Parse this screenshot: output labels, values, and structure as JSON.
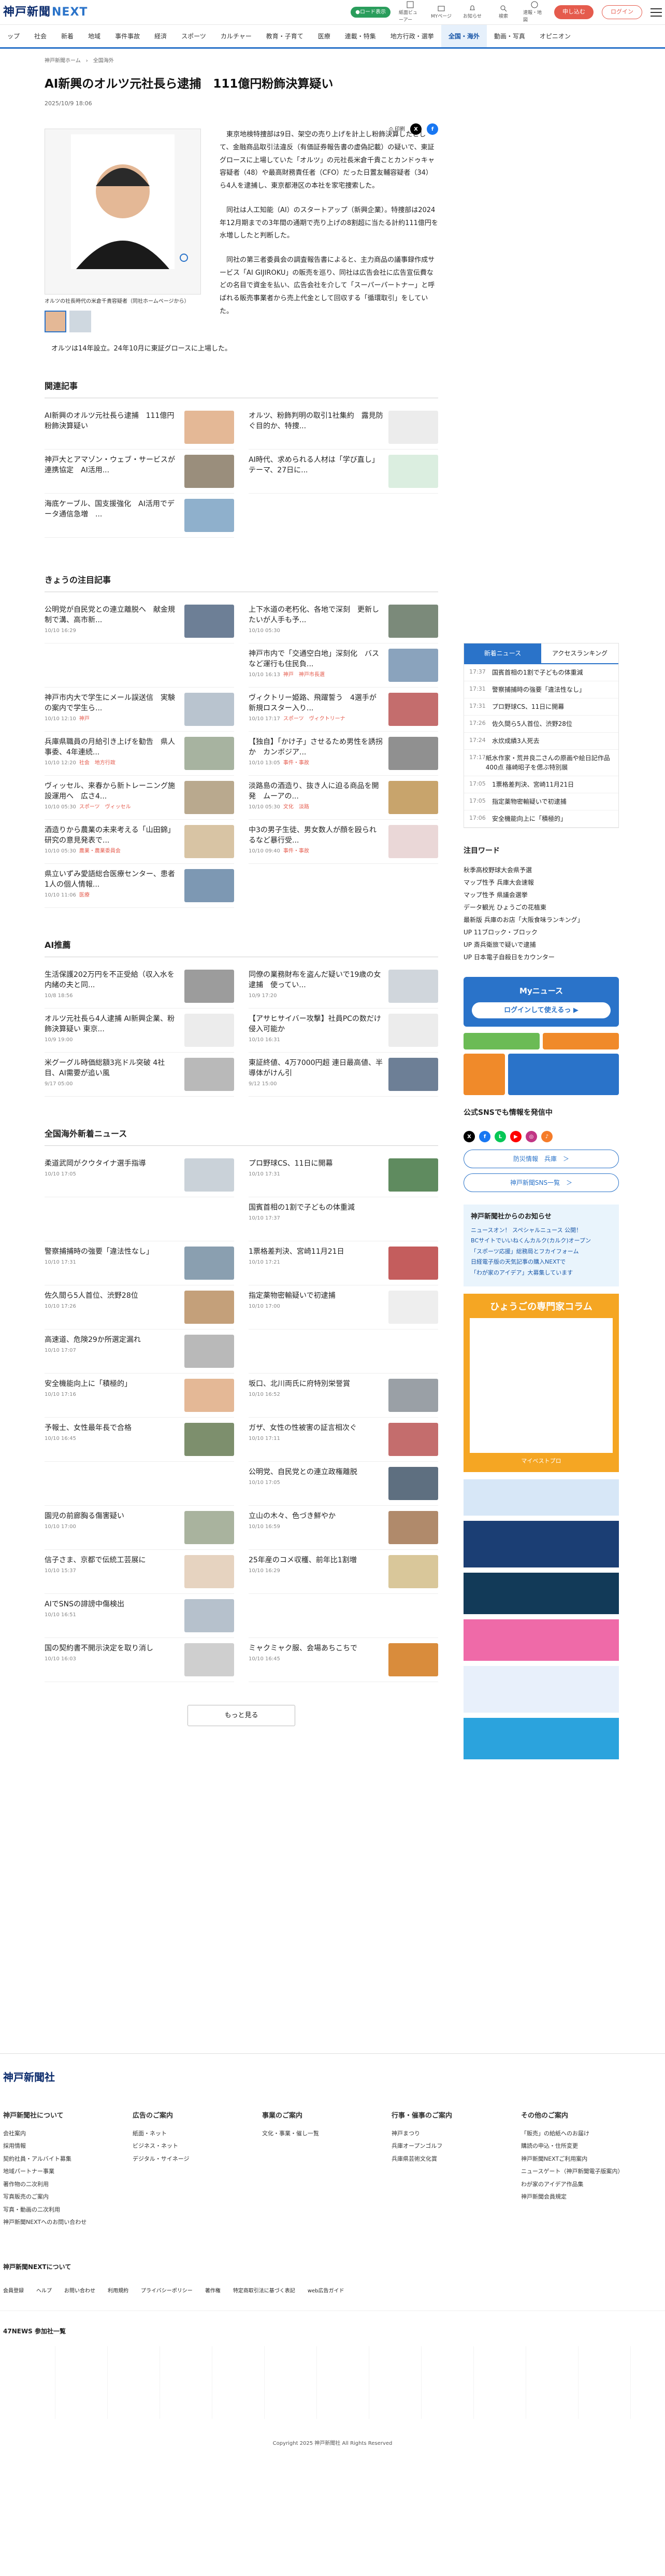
{
  "header": {
    "logo_main": "神戸新聞",
    "logo_sub": "NEXT",
    "top_pill": "●ロード表示",
    "icons": [
      {
        "name": "paper-icon",
        "label": "紙面ビューアー"
      },
      {
        "name": "myfolder-icon",
        "label": "MYページ"
      },
      {
        "name": "bell-icon",
        "label": "お知らせ"
      },
      {
        "name": "search-icon",
        "label": "検索"
      },
      {
        "name": "sitemap-icon",
        "label": "速報・地図"
      }
    ],
    "apply": "申し込む",
    "login": "ログイン"
  },
  "gnav": [
    "ップ",
    "社会",
    "事件事故",
    "新着",
    "地域",
    "経済",
    "スポーツ",
    "カルチャー",
    "教育・子育て",
    "医療",
    "連載・特集",
    "地方行政・選挙",
    "全国・海外",
    "動画・写真",
    "オピニオン"
  ],
  "breadcrumb": [
    "神戸新聞ホーム",
    "全国海外"
  ],
  "article": {
    "title": "AI新興のオルツ元社長ら逮捕　111億円粉飾決算疑い",
    "date": "2025/10/9 18:06",
    "print": "印刷",
    "photo_caption": "オルツの社長時代の米倉千貴容疑者（同社ホームページから）",
    "paragraphs": [
      "　東京地検特捜部は9日、架空の売り上げを計上し粉飾決算したとして、金融商品取引法違反（有価証券報告書の虚偽記載）の疑いで、東証グロースに上場していた「オルツ」の元社長米倉千貴ことカンドゥキャ容疑者（48）や最高財務責任者（CFO）だった日置友輔容疑者（34）ら4人を逮捕し、東京都港区の本社を家宅捜索した。",
      "　同社は人工知能（AI）のスタートアップ（新興企業）。特捜部は2024年12月期までの3年間の通期で売り上げの8割超に当たる計約111億円を水増ししたと判断した。",
      "　同社の第三者委員会の調査報告書によると、主力商品の議事録作成サービス「AI GIJIROKU」の販売を巡り、同社は広告会社に広告宣伝費などの名目で資金を払い、広告会社を介して「スーパーパートナー」と呼ばれる販売事業者から売上代金として回収する「循環取引」をしていた。",
      "　オルツは14年設立。24年10月に東証グロースに上場した。"
    ]
  },
  "related": {
    "heading": "関連記事",
    "items": [
      {
        "title": "AI新興のオルツ元社長ら逮捕　111億円粉飾決算疑い",
        "meta": ""
      },
      {
        "title": "オルツ、粉飾判明の取引1社集約　露見防ぐ目的か、特捜...",
        "meta": ""
      },
      {
        "title": "神戸大とアマゾン・ウェブ・サービスが連携協定　AI活用...",
        "meta": ""
      },
      {
        "title": "AI時代、求められる人材は「学び直し」テーマ、27日に...",
        "meta": ""
      },
      {
        "title": "海底ケーブル、国支援強化　AI活用でデータ通信急増　...",
        "meta": ""
      }
    ]
  },
  "today": {
    "heading": "きょうの注目記事",
    "items": [
      {
        "title": "公明党が自民党との連立離脱へ　献金規制で溝、高市新...",
        "meta": "10/10 16:29"
      },
      {
        "title": "上下水道の老朽化、各地で深刻　更新したいが人手も予...",
        "meta": "10/10 05:30"
      },
      {
        "title": "",
        "meta": ""
      },
      {
        "title": "神戸市内で「交通空白地」深刻化　バスなど運行も住民負...",
        "meta": "10/10 16:13",
        "cat": "神戸　神戸市長選"
      },
      {
        "title": "神戸市内大で学生にメール誤送信　実験の案内で学生ら...",
        "meta": "10/10 12:10",
        "cat": "神戸"
      },
      {
        "title": "ヴィクトリー姫路、飛躍誓う　4選手が新規ロスター入り...",
        "meta": "10/10 17:17",
        "cat": "スポーツ　ヴィクトリーナ"
      },
      {
        "title": "兵庫県職員の月給引き上げを勧告　県人事委、4年連続...",
        "meta": "10/10 12:20",
        "cat": "社会　地方行政"
      },
      {
        "title": "【独自】「かけ子」させるため男性を誘拐か　カンボジア...",
        "meta": "10/10 13:05",
        "cat": "事件・事故"
      },
      {
        "title": "ヴィッセル、来春から新トレーニング施設運用へ　広さ4...",
        "meta": "10/10 05:30",
        "cat": "スポーツ　ヴィッセル"
      },
      {
        "title": "淡路島の酒造り、抜き人に迫る商品を開発　ムーアの...",
        "meta": "10/10 05:30",
        "cat": "文化　淡路"
      },
      {
        "title": "酒造りから農業の未来考える「山田錦」研究の意見発表で...",
        "meta": "10/10 05:30",
        "cat": "農業・農業委員会"
      },
      {
        "title": "中3の男子生徒、男女数人が顔を殴られるなど暴行受...",
        "meta": "10/10 09:40",
        "cat": "事件・事故"
      },
      {
        "title": "県立いずみ愛語総合医療センター、患者1人の個人情報...",
        "meta": "10/10 11:06",
        "cat": "医療"
      }
    ]
  },
  "ai": {
    "heading": "AI推薦",
    "items": [
      {
        "title": "生活保護202万円を不正受給（収入水を内緒の夫と同...",
        "meta": "10/8 18:56"
      },
      {
        "title": "同僚の業務財布を盗んだ疑いで19歳の女逮捕　使ってい...",
        "meta": "10/9 17:20"
      },
      {
        "title": "オルツ元社長ら4人逮捕 AI新興企業、粉飾決算疑い 東京...",
        "meta": "10/9 19:00"
      },
      {
        "title": "【アサヒサイバー攻撃】社員PCの数だけ侵入可能か",
        "meta": "10/10 16:31"
      },
      {
        "title": "米グーグル時価総額3兆ドル突破 4社目、AI需要が追い風",
        "meta": "9/17 05:00"
      },
      {
        "title": "東証終値、4万7000円超 連日最高値、半導体がけん引",
        "meta": "9/12 15:00"
      }
    ]
  },
  "national": {
    "heading": "全国海外新着ニュース",
    "items": [
      {
        "title": "柔道武岡がクウタイナ選手指導",
        "meta": "10/10 17:05"
      },
      {
        "title": "プロ野球CS、11日に開幕",
        "meta": "10/10 17:31"
      },
      {
        "title": "",
        "meta": ""
      },
      {
        "title": "国賓首相の1割で子どもの体重減",
        "meta": "10/10 17:37"
      },
      {
        "title": "警察捕捕時の強要「違法性なし」",
        "meta": "10/10 17:31"
      },
      {
        "title": "1票格差判決、宮崎11月21日",
        "meta": "10/10 17:21"
      },
      {
        "title": "佐久間ら5人首位、渋野28位",
        "meta": "10/10 17:26"
      },
      {
        "title": "指定薬物密輸疑いで初逮捕",
        "meta": "10/10 17:00"
      },
      {
        "title": "高速道、危険29か所選定漏れ",
        "meta": "10/10 17:07"
      },
      {
        "title": "",
        "meta": ""
      },
      {
        "title": "安全機能向上に「積極的」",
        "meta": "10/10 17:16"
      },
      {
        "title": "坂口、北川両氏に府特別栄誉賞",
        "meta": "10/10 16:52"
      },
      {
        "title": "予報士、女性最年長で合格",
        "meta": "10/10 16:45"
      },
      {
        "title": "ガザ、女性の性被害の証言相次ぐ",
        "meta": "10/10 17:11"
      },
      {
        "title": "",
        "meta": ""
      },
      {
        "title": "公明党、自民党との連立政権離脱",
        "meta": "10/10 17:05"
      },
      {
        "title": "園児の前廊胸る傷害疑い",
        "meta": "10/10 17:00"
      },
      {
        "title": "立山の木々、色づき鮮やか",
        "meta": "10/10 16:59"
      },
      {
        "title": "信子さま、京都で伝統工芸展に",
        "meta": "10/10 15:37"
      },
      {
        "title": "25年産のコメ収穫、前年比1割増",
        "meta": "10/10 16:29"
      },
      {
        "title": "AIでSNSの誹謗中傷検出",
        "meta": "10/10 16:51"
      },
      {
        "title": "",
        "meta": ""
      },
      {
        "title": "国の契約書不開示決定を取り消し",
        "meta": "10/10 16:03"
      },
      {
        "title": "ミャクミャク服、会場あちこちで",
        "meta": "10/10 16:45"
      }
    ],
    "more": "もっと見る"
  },
  "side": {
    "tabs": [
      "新着ニュース",
      "アクセスランキング"
    ],
    "ranks": [
      [
        "17:37",
        "国賓首相の1割で子どもの体重減"
      ],
      [
        "17:31",
        "警察捕捕時の強要「違法性なし」"
      ],
      [
        "17:31",
        "プロ野球CS、11日に開幕"
      ],
      [
        "17:26",
        "佐久間ら5人首位、渋野28位"
      ],
      [
        "17:24",
        "水炊成績3人死去"
      ],
      [
        "17:17",
        "紙水作家・荒井良二さんの原画や絵日記作品400点 篠崎昭子を偲ぶ特別展"
      ],
      [
        "17:05",
        "1票格差判決、宮崎11月21日"
      ],
      [
        "17:05",
        "指定薬物密輸疑いで初逮捕"
      ],
      [
        "17:06",
        "安全機能向上に「積極的」"
      ]
    ],
    "ward_h": "注目ワード",
    "wards": [
      "秋季高校野球大会県予選",
      "マップ性予 兵庫大会速報",
      "マップ性予 県議会選挙",
      "データ観光 ひょうごの花植東",
      "最新版 兵庫のお店「大阪食味ランキング」",
      "UP 11ブロック・ブロック",
      "UP 斎兵衛旅で疑いで逮捕",
      "UP 日本電子自殺日をカウンター"
    ],
    "my": "Myニュース",
    "my_sub": "ログインして使えるっ ▶",
    "sns_h": "公式SNSでも情報を発信中",
    "btn1": "防災情報　兵庫　＞",
    "btn2": "神戸新聞SNS一覧　＞",
    "notice_h": "神戸新聞社からのお知らせ",
    "notices": [
      "ニュースオン！ スペシャルニュース 公開！",
      "BCサイトでいいねくんカルク(カルク)オープン",
      "「スポーツ応援」総務局とフカイフォーム",
      "日経電子版の天気記事の購入NEXTで",
      "「わが家のアイデア」大募集しています"
    ],
    "promo_h": "ひょうごの専門家コラム",
    "promo_sub": "マイベストプロ"
  },
  "footer": {
    "brand": "神戸新聞社",
    "cols": [
      {
        "h": "神戸新聞社について",
        "items": [
          "会社案内",
          "採用情報",
          "契約社員・アルバイト募集",
          "",
          "地域パートナー事業",
          "著作物の二次利用",
          "写真販売のご案内",
          "写真・動画の二次利用",
          "神戸新聞NEXTへのお問い合わせ"
        ]
      },
      {
        "h": "広告のご案内",
        "items": [
          "紙面・ネット",
          "ビジネス・ネット",
          "デジタル・サイネージ"
        ]
      },
      {
        "h": "事業のご案内",
        "items": [
          "文化・事業・催し一覧"
        ]
      },
      {
        "h": "行事・催事のご案内",
        "items": [
          "神戸まつり",
          "兵庫オープンゴルフ",
          "兵庫県芸術文化賞"
        ]
      },
      {
        "h": "その他のご案内",
        "items": [
          "「販売」の給紙へのお届け",
          "購読の申込・住所変更",
          "神戸新聞NEXTご利用案内",
          "ニュースゲート（神戸新聞電子版案内）",
          "わが家のアイデア作品集",
          "神戸新聞会員規定"
        ]
      }
    ],
    "next_h": "神戸新聞NEXTについて",
    "next_items": [
      "会員登録",
      "ヘルプ",
      "お問い合わせ",
      "利用規約",
      "プライバシーポリシー",
      "著作権",
      "特定商取引法に基づく表記",
      "web広告ガイド"
    ],
    "n47": "47NEWS 参加社一覧",
    "copyright": "Copyright 2025 神戸新聞社 All Rights Reserved"
  }
}
